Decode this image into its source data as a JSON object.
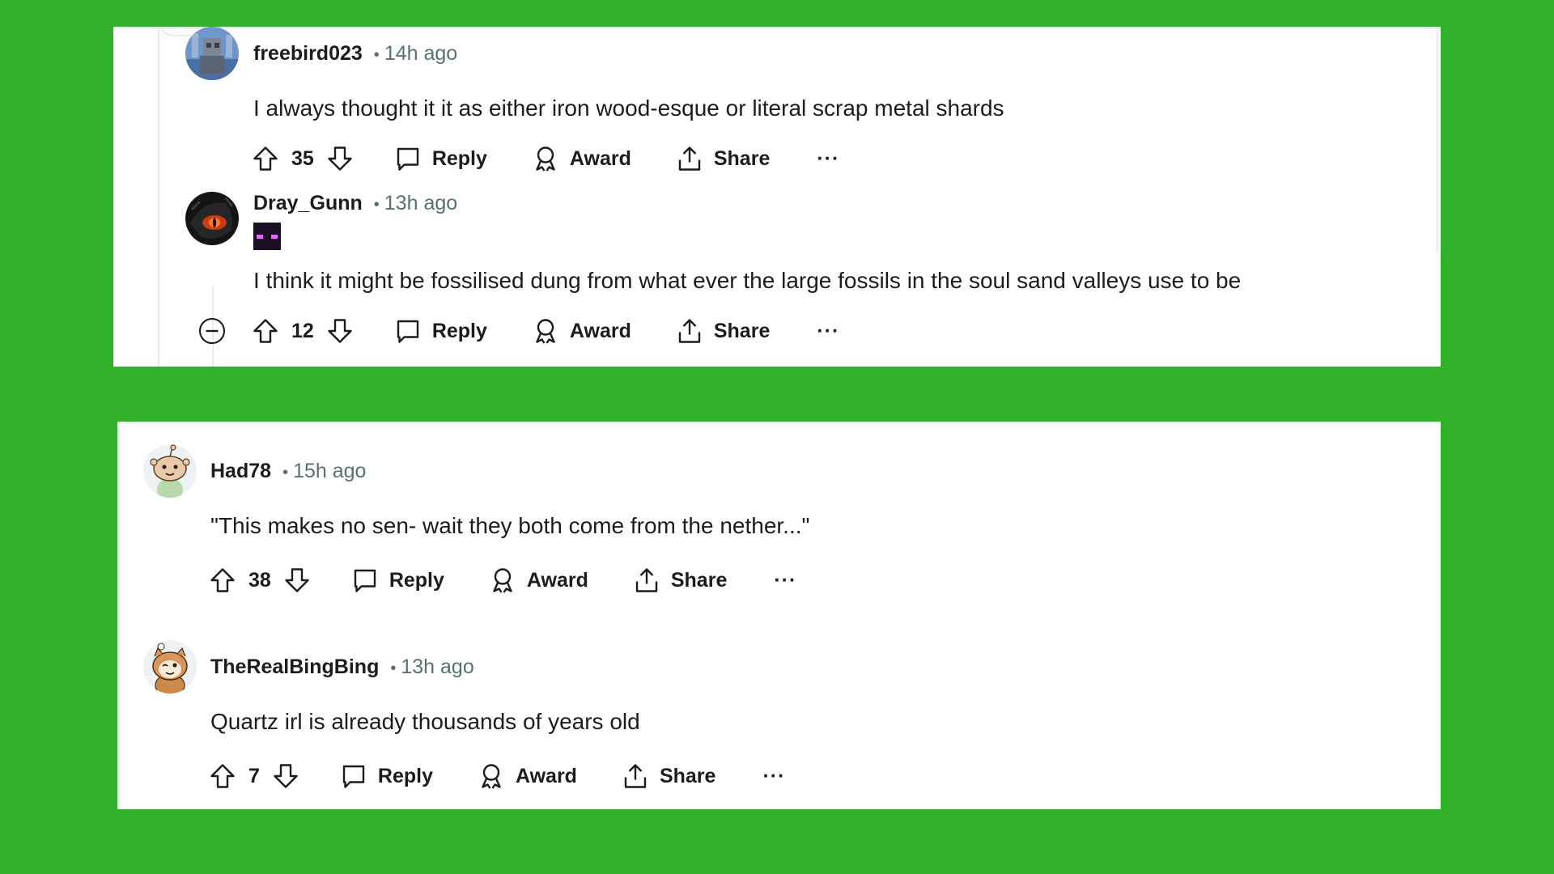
{
  "comments": [
    {
      "username": "freebird023",
      "time": "14h ago",
      "body": "I always thought it it as either iron wood-esque or literal scrap metal shards",
      "votes": "35"
    },
    {
      "username": "Dray_Gunn",
      "time": "13h ago",
      "body": "I think it might be fossilised dung from what ever the large fossils in the soul sand valleys use to be",
      "votes": "12"
    },
    {
      "username": "Had78",
      "time": "15h ago",
      "body": "\"This makes no sen- wait they both come from the nether...\"",
      "votes": "38"
    },
    {
      "username": "TheRealBingBing",
      "time": "13h ago",
      "body": "Quartz irl is already thousands of years old",
      "votes": "7"
    }
  ],
  "actions": {
    "reply": "Reply",
    "award": "Award",
    "share": "Share",
    "more": "···"
  },
  "icons": {
    "upvote": "arrow-up-icon",
    "downvote": "arrow-down-icon",
    "reply": "speech-bubble-icon",
    "award": "award-ribbon-icon",
    "share": "share-upload-icon",
    "collapse": "minus-circle-icon"
  },
  "colors": {
    "background": "#31b02a",
    "panel": "#ffffff",
    "muted_text": "#576f76",
    "thread_line": "#e5ebee"
  }
}
